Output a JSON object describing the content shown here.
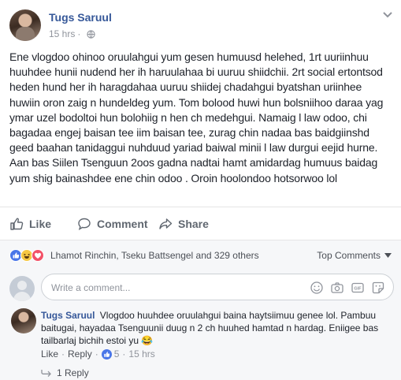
{
  "post": {
    "author": "Tugs Saruul",
    "time": "15 hrs",
    "separator": "·",
    "text": "Ene vlogdoo ohinoo oruulahgui yum gesen humuusd helehed, 1rt uuriinhuu huuhdee hunii nudend her ih haruulahaa bi uuruu shiidchii. 2rt social ertontsod heden hund her ih haragdahaa uuruu shiidej chadahgui byatshan uriinhee huwiin oron zaig n hundeldeg yum. Tom bolood huwi hun bolsniihoo daraa yag ymar uzel bodoltoi hun bolohiig n hen ch medehgui. Namaig l law odoo, chi bagadaa engej baisan tee iim baisan tee, zurag chin nadaa bas baidgiinshd geed baahan tanidaggui nuhduud yariad baiwal minii l law durgui eejid hurne. Aan bas Siilen Tsenguun 2oos gadna nadtai hamt amidardag humuus baidag yum shig bainashdee ene chin odoo . Oroin hoolondoo hotsorwoo lol"
  },
  "actions": {
    "like": "Like",
    "comment": "Comment",
    "share": "Share"
  },
  "reactions": {
    "icons": [
      "like-icon",
      "haha-icon",
      "love-icon"
    ],
    "names": "Lhamot Rinchin, Tseku Battsengel and 329 others",
    "sort_label": "Top Comments"
  },
  "composer": {
    "placeholder": "Write a comment...",
    "icons": [
      "emoji-icon",
      "camera-icon",
      "gif-icon",
      "sticker-icon"
    ]
  },
  "comment": {
    "author": "Tugs Saruul",
    "text": "Vlogdoo huuhdee oruulahgui baina haytsiimuu genee lol. Pambuu baitugai, hayadaa Tsenguunii duug n 2 ch huuhed hamtad n hardag. Eniigee bas tailbarlaj bichih estoi yu 😂",
    "like": "Like",
    "reply": "Reply",
    "like_count": "5",
    "time": "15 hrs",
    "replies": "1 Reply"
  },
  "colors": {
    "link": "#365899",
    "muted": "#90949c",
    "like_blue": "#4a76e8"
  }
}
